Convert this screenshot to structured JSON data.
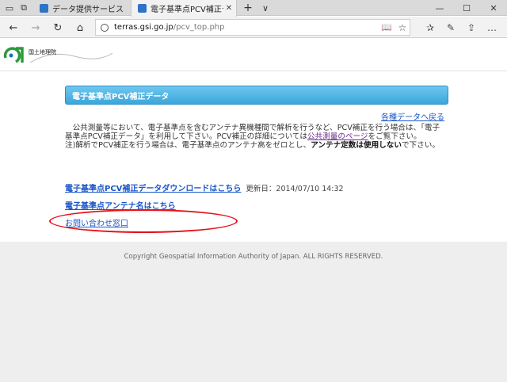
{
  "browser": {
    "tabs": [
      {
        "label": "データ提供サービス",
        "active": false
      },
      {
        "label": "電子基準点PCV補正デー",
        "active": true
      }
    ],
    "new_tab": "+",
    "tab_menu": "∨",
    "close_tab": "✕",
    "window_controls": {
      "minimize": "—",
      "maximize": "☐",
      "close": "✕"
    },
    "nav": {
      "back": "←",
      "forward": "→",
      "refresh": "↻",
      "home": "⌂"
    },
    "address": {
      "host": "terras.gsi.go.jp",
      "path": "/pcv_top.php"
    },
    "actions": {
      "reading_view": "📖",
      "favorite": "☆",
      "favorites_hub": "✰",
      "notes": "✎",
      "share": "⇪",
      "more": "…"
    }
  },
  "page": {
    "logo_text": "国土地理院",
    "section_title": "電子基準点PCV補正データ",
    "back_link": "各種データへ戻る",
    "paragraph": {
      "line1": "　公共測量等において、電子基準点を含むアンテナ異機種間で解析を行うなど、PCV補正を行う場合は、「電子",
      "line2_a": "基準点PCV補正データ」を利用して下さい。PCV補正の詳細については",
      "line2_link": "公共測量のページ",
      "line2_b": "をご覧下さい。",
      "line3_a": "注)解析でPCV補正を行う場合は、電子基準点のアンテナ高をゼロとし、",
      "line3_bold": "アンテナ定数は使用しない",
      "line3_b": "で下さい。"
    },
    "download_link": "電子基準点PCV補正データダウンロードはこちら",
    "updated": "更新日：2014/07/10 14:32",
    "antenna_link": "電子基準点アンテナ名はこちら",
    "contact_link": "お問い合わせ窓口",
    "footer": "Copyright  Geospatial Information Authority of Japan. ALL RIGHTS RESERVED.",
    "accent_color": "#3aa7dc",
    "highlight_color": "#e5141b"
  }
}
